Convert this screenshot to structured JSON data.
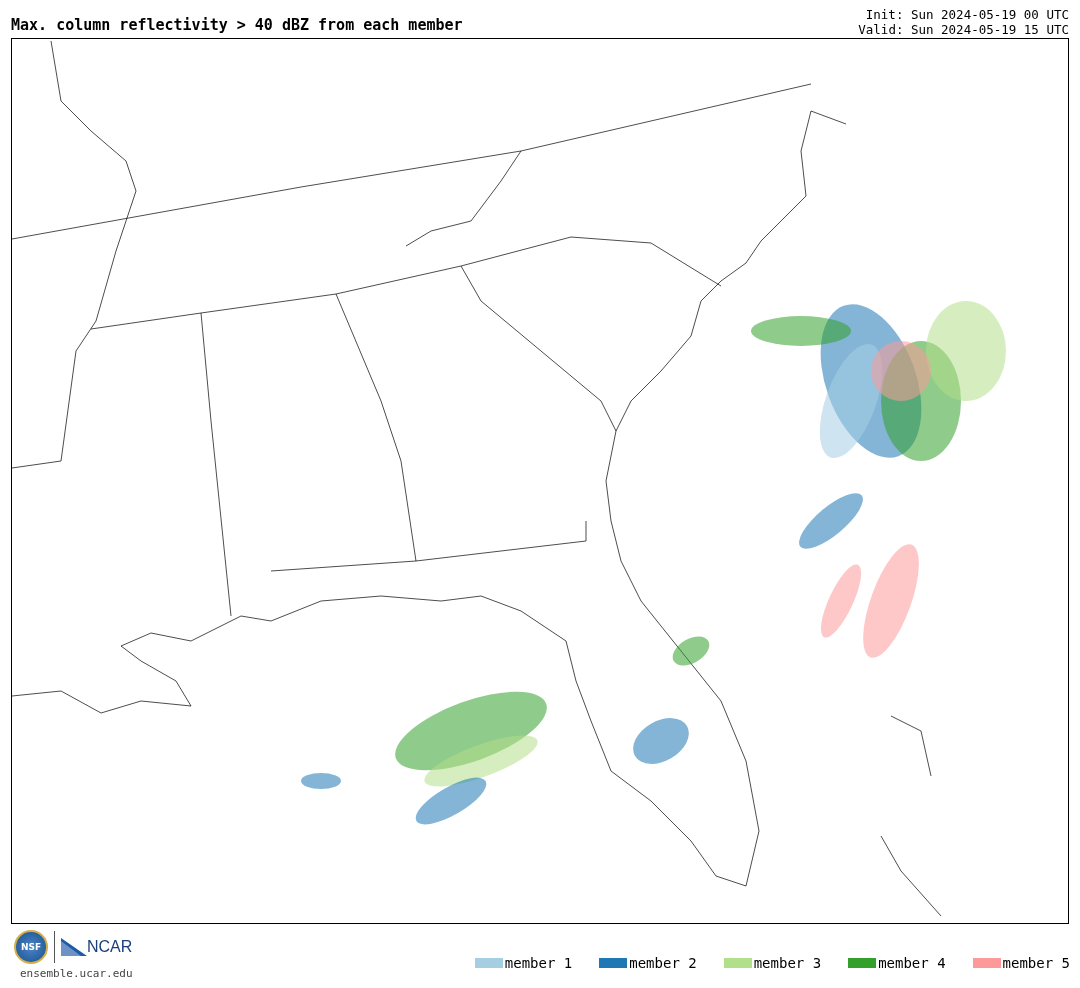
{
  "title": "Max. column reflectivity > 40 dBZ from each member",
  "init": "Init: Sun 2024-05-19 00 UTC",
  "valid": "Valid: Sun 2024-05-19 15 UTC",
  "logos": {
    "nsf": "NSF",
    "ncar": "NCAR"
  },
  "site": "ensemble.ucar.edu",
  "legend": [
    {
      "label": "member 1",
      "color": "#a6cee3"
    },
    {
      "label": "member 2",
      "color": "#1f78b4"
    },
    {
      "label": "member 3",
      "color": "#b2df8a"
    },
    {
      "label": "member 4",
      "color": "#33a02c"
    },
    {
      "label": "member 5",
      "color": "#fb9a99"
    }
  ]
}
